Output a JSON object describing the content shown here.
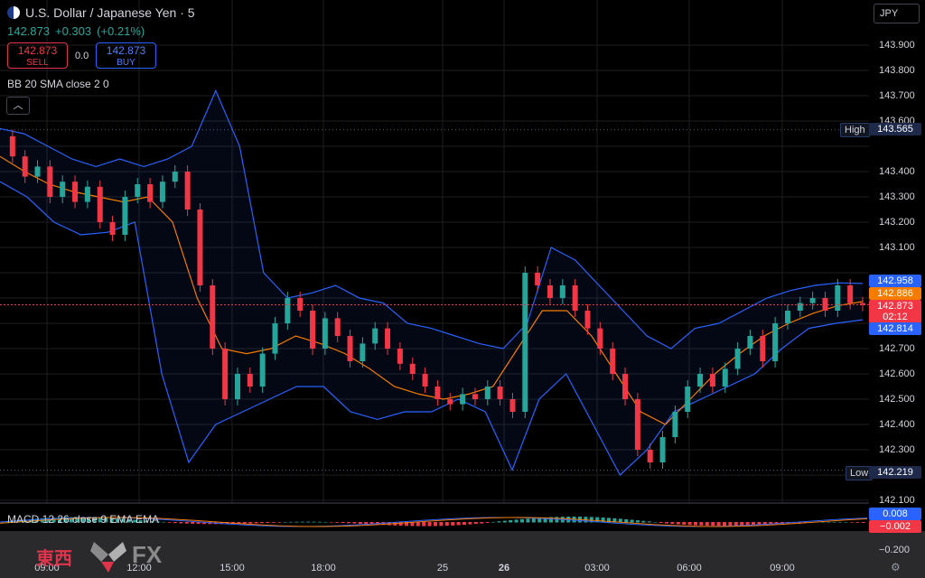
{
  "header": {
    "title": "U.S. Dollar / Japanese Yen · 5",
    "last_price": "142.873",
    "change": "+0.303",
    "change_pct": "(+0.21%)"
  },
  "trade": {
    "sell_price": "142.873",
    "sell_label": "SELL",
    "spread": "0.0",
    "buy_price": "142.873",
    "buy_label": "BUY"
  },
  "indicators": {
    "bb_label": "BB 20 SMA close 2 0",
    "macd_label": "MACD 12 26 close 9 EMA EMA"
  },
  "currency_button": "JPY",
  "price_axis": {
    "ticks": [
      "143.900",
      "143.800",
      "143.700",
      "143.600",
      "143.400",
      "143.300",
      "143.200",
      "143.100",
      "142.700",
      "142.600",
      "142.500",
      "142.400",
      "142.300",
      "142.100"
    ]
  },
  "tags": {
    "high_label": "High",
    "high_value": "143.565",
    "low_label": "Low",
    "low_value": "142.219",
    "upper_band": "142.958",
    "basis": "142.886",
    "current": "142.873",
    "countdown": "02:12",
    "lower_band": "142.814",
    "macd_val": "0.008",
    "macd_signal": "−0.002",
    "macd_tick": "−0.200"
  },
  "time_axis": [
    "09:00",
    "12:00",
    "15:00",
    "18:00",
    "25",
    "26",
    "03:00",
    "06:00",
    "09:00"
  ],
  "watermark": {
    "cn": "東西",
    "fx": "FX"
  },
  "colors": {
    "up": "#26a69a",
    "down": "#f23645",
    "band": "#2962ff",
    "basis": "#f57c00",
    "current": "#f23645"
  },
  "chart_data": {
    "type": "candlestick",
    "symbol": "USD/JPY",
    "interval": "5",
    "ylim": [
      142.1,
      144.0
    ],
    "high": 143.565,
    "low": 142.219,
    "last": 142.873,
    "close_series": [
      143.54,
      143.46,
      143.38,
      143.42,
      143.3,
      143.36,
      143.28,
      143.34,
      143.2,
      143.15,
      143.3,
      143.35,
      143.28,
      143.36,
      143.4,
      143.25,
      142.95,
      142.7,
      142.5,
      142.6,
      142.55,
      142.68,
      142.8,
      142.9,
      142.85,
      142.7,
      142.82,
      142.75,
      142.65,
      142.72,
      142.78,
      142.7,
      142.64,
      142.6,
      142.55,
      142.5,
      142.48,
      142.52,
      142.5,
      142.55,
      142.5,
      142.45,
      143.0,
      142.95,
      142.9,
      142.95,
      142.85,
      142.78,
      142.7,
      142.6,
      142.5,
      142.3,
      142.25,
      142.35,
      142.45,
      142.55,
      142.6,
      142.55,
      142.62,
      142.7,
      142.75,
      142.65,
      142.8,
      142.85,
      142.88,
      142.9,
      142.85,
      142.95,
      142.88,
      142.873
    ],
    "upper_band": [
      143.57,
      143.55,
      143.5,
      143.45,
      143.42,
      143.45,
      143.42,
      143.45,
      143.5,
      143.72,
      143.5,
      143.0,
      142.9,
      142.92,
      142.95,
      142.9,
      142.88,
      142.8,
      142.78,
      142.75,
      142.72,
      142.7,
      142.8,
      143.1,
      143.05,
      142.95,
      142.85,
      142.75,
      142.7,
      142.78,
      142.8,
      142.85,
      142.9,
      142.93,
      142.95,
      142.96,
      142.958
    ],
    "basis": [
      143.46,
      143.4,
      143.35,
      143.32,
      143.3,
      143.28,
      143.3,
      143.2,
      142.9,
      142.7,
      142.68,
      142.7,
      142.75,
      142.72,
      142.68,
      142.62,
      142.55,
      142.52,
      142.5,
      142.52,
      142.55,
      142.7,
      142.85,
      142.85,
      142.75,
      142.6,
      142.45,
      142.4,
      142.5,
      142.6,
      142.68,
      142.75,
      142.8,
      142.84,
      142.87,
      142.886
    ],
    "lower_band": [
      143.36,
      143.3,
      143.2,
      143.15,
      143.16,
      143.2,
      142.6,
      142.25,
      142.4,
      142.45,
      142.5,
      142.55,
      142.55,
      142.45,
      142.42,
      142.45,
      142.45,
      142.5,
      142.45,
      142.22,
      142.5,
      142.6,
      142.4,
      142.2,
      142.3,
      142.45,
      142.5,
      142.55,
      142.6,
      142.7,
      142.78,
      142.8,
      142.814
    ],
    "macd": {
      "macd": 0.008,
      "signal": -0.002
    }
  }
}
